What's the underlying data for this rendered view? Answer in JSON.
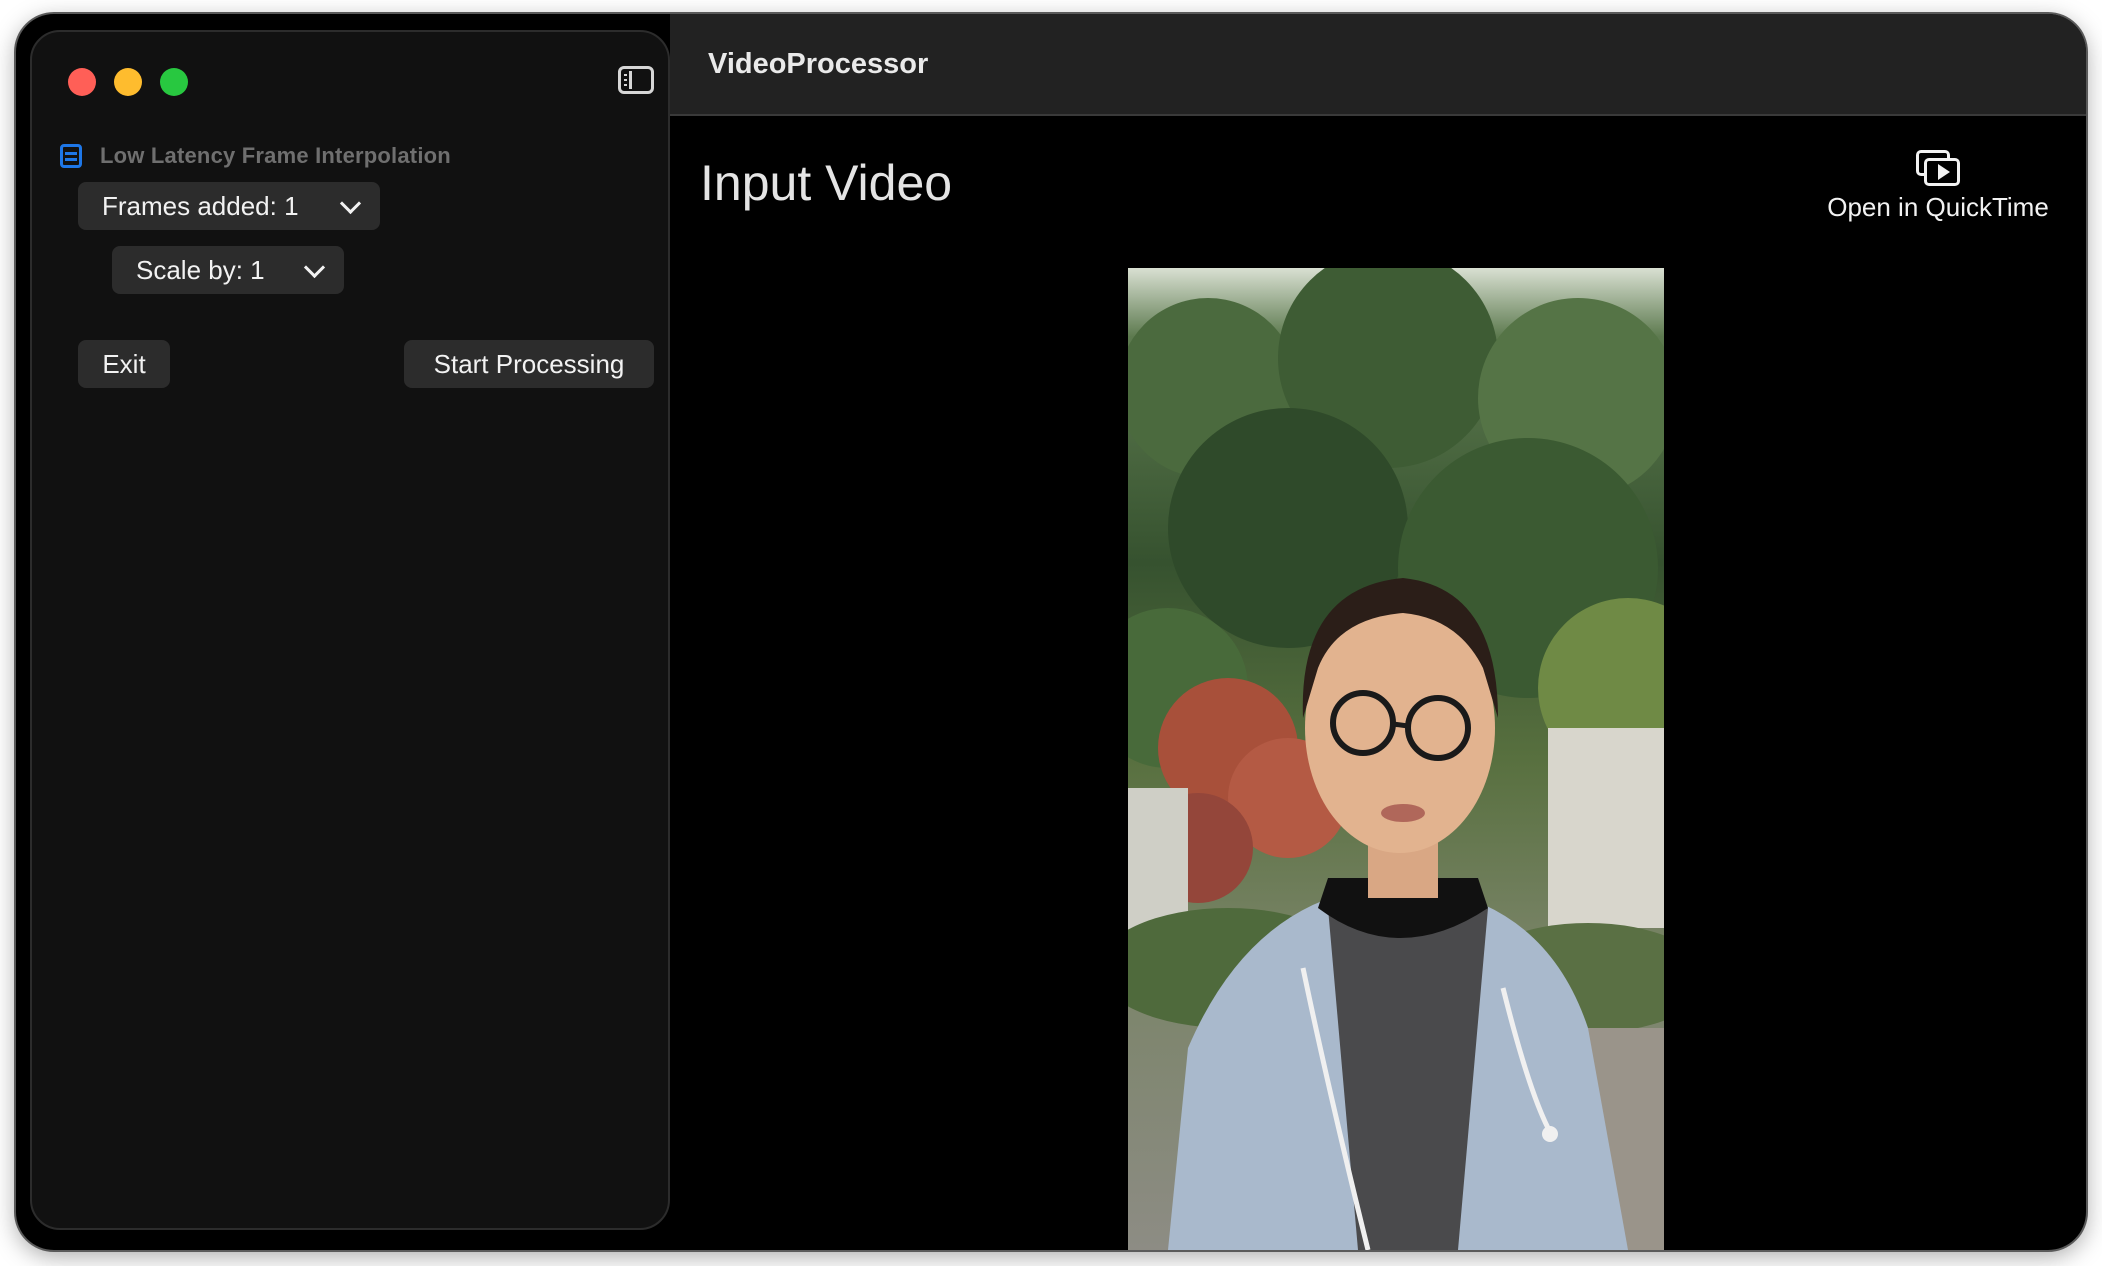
{
  "sidebar": {
    "section_title": "Low Latency Frame Interpolation",
    "section_icon": "film-icon",
    "frames_dropdown_label": "Frames added: 1",
    "scale_dropdown_label": "Scale by: 1",
    "exit_label": "Exit",
    "start_label": "Start Processing"
  },
  "titlebar": {
    "title": "VideoProcessor"
  },
  "main": {
    "heading": "Input Video",
    "quicktime_label": "Open in QuickTime"
  },
  "colors": {
    "accent": "#1e77e8",
    "close": "#ff5f57",
    "minimize": "#febc2e",
    "maximize": "#28c840"
  }
}
